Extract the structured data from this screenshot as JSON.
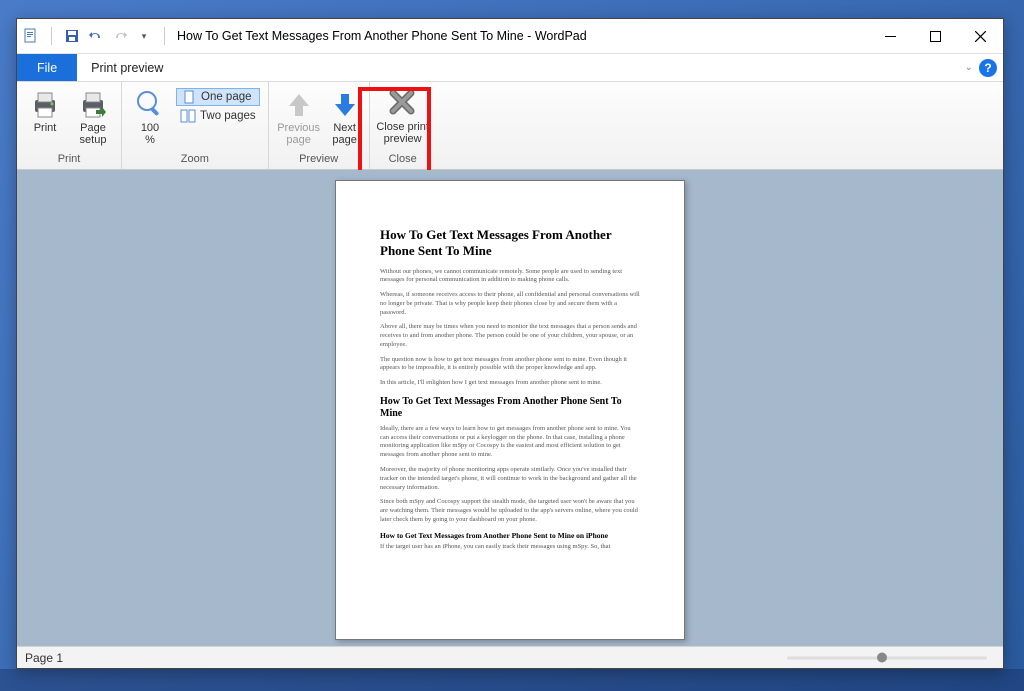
{
  "window": {
    "title": "How To Get Text Messages From Another Phone Sent To Mine - WordPad"
  },
  "tabs": {
    "file": "File",
    "preview": "Print preview"
  },
  "ribbon": {
    "print_group": {
      "print": "Print",
      "page_setup_l1": "Page",
      "page_setup_l2": "setup",
      "label": "Print"
    },
    "zoom_group": {
      "percent_l1": "100",
      "percent_l2": "%",
      "one_page": "One page",
      "two_pages": "Two pages",
      "label": "Zoom"
    },
    "preview_group": {
      "prev_l1": "Previous",
      "prev_l2": "page",
      "next_l1": "Next",
      "next_l2": "page",
      "label": "Preview"
    },
    "close_group": {
      "close_l1": "Close print",
      "close_l2": "preview",
      "label": "Close"
    }
  },
  "document": {
    "h1": "How To Get Text Messages From Another Phone Sent To Mine",
    "p1": "Without our phones, we cannot communicate remotely. Some people are used to sending text messages for personal communication in addition to making phone calls.",
    "p2": "Whereas, if someone receives access to their phone, all confidential and personal conversations will no longer be private. That is why people keep their phones close by and secure them with a password.",
    "p3": "Above all, there may be times when you need to monitor the text messages that a person sends and receives to and from another phone. The person could be one of your children, your spouse, or an employee.",
    "p4": "The question now is how to get text messages from another phone sent to mine. Even though it appears to be impossible, it is entirely possible with the proper knowledge and app.",
    "p5": "In this article, I'll enlighten how I get text messages from another phone sent to mine.",
    "h2": "How To Get Text Messages From Another Phone Sent To Mine",
    "p6": "Ideally, there are a few ways to learn how to get messages from another phone sent to mine. You can access their conversations or put a keylogger on the phone. In that case, installing a phone monitoring application like mSpy or Cocospy is the easiest and most efficient solution to get messages from another phone sent to mine.",
    "p7": "Moreover, the majority of phone monitoring apps operate similarly. Once you've installed their tracker on the intended target's phone, it will continue to work in the background and gather all the necessary information.",
    "p8": "Since both mSpy and Cocospy support the stealth mode, the targeted user won't be aware that you are watching them. Their messages would be uploaded to the app's servers online, where you could later check them by going to your dashboard on your phone.",
    "h3": "How to Get Text Messages from Another Phone Sent to Mine on iPhone",
    "p9": "If the target user has an iPhone, you can easily track their messages using mSpy. So, that"
  },
  "status": {
    "page": "Page 1"
  }
}
